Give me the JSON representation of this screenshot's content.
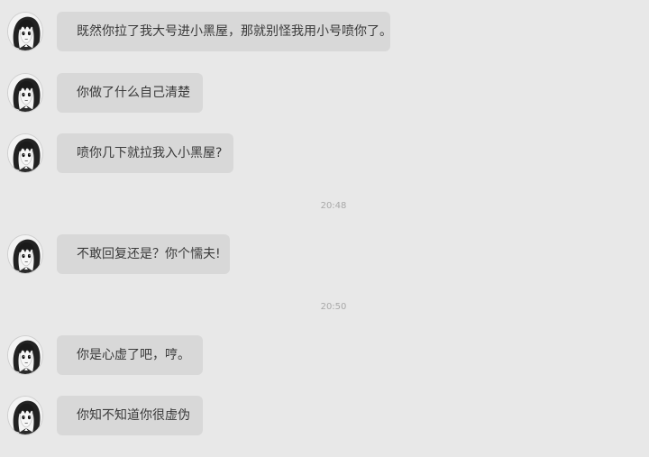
{
  "messages": [
    {
      "type": "msg",
      "text": "既然你拉了我大号进小黑屋，那就别怪我用小号喷你了。",
      "avatar": "anime-girl-avatar"
    },
    {
      "type": "msg",
      "text": "你做了什么自己清楚",
      "avatar": "anime-girl-avatar"
    },
    {
      "type": "msg",
      "text": "喷你几下就拉我入小黑屋?",
      "avatar": "anime-girl-avatar"
    },
    {
      "type": "time",
      "text": "20:48"
    },
    {
      "type": "msg",
      "text": "不敢回复还是？你个懦夫!",
      "avatar": "anime-girl-avatar"
    },
    {
      "type": "time",
      "text": "20:50"
    },
    {
      "type": "msg",
      "text": "你是心虚了吧，哼。",
      "avatar": "anime-girl-avatar"
    },
    {
      "type": "msg",
      "text": "你知不知道你很虚伪",
      "avatar": "anime-girl-avatar"
    }
  ],
  "colors": {
    "background": "#e8e8e8",
    "bubble": "#d8d8d8",
    "text": "#3a3a3a",
    "timestamp": "#a8a8a8"
  }
}
